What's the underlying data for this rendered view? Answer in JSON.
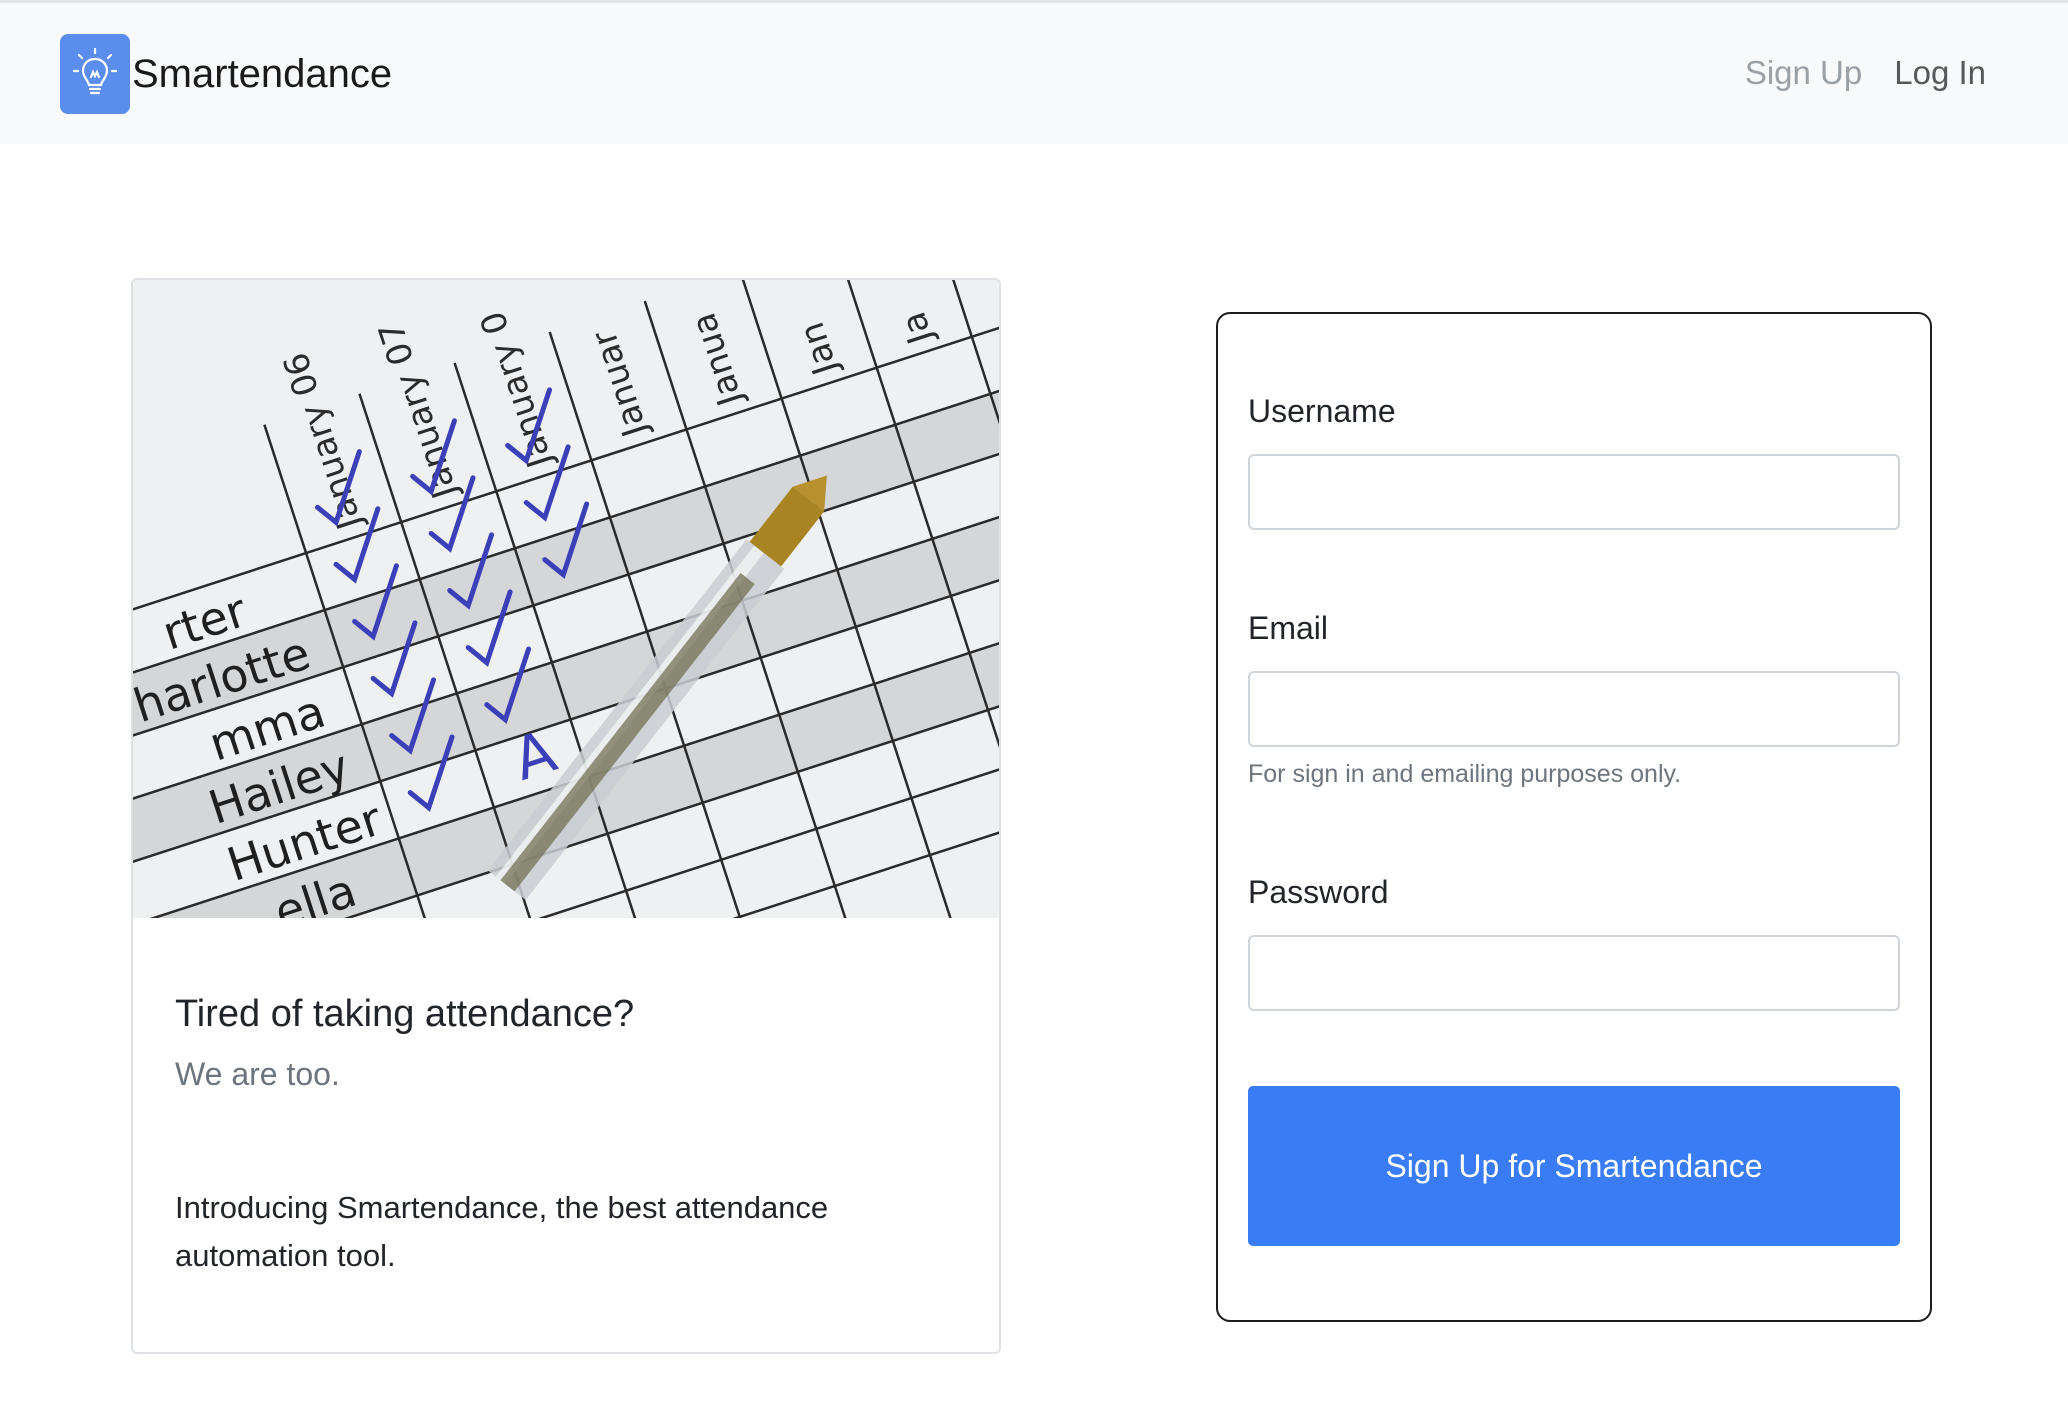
{
  "navbar": {
    "brand": "Smartendance",
    "links": [
      {
        "label": "Sign Up",
        "active": false
      },
      {
        "label": "Log In",
        "active": true
      }
    ]
  },
  "card": {
    "title": "Tired of taking attendance?",
    "subtitle": "We are too.",
    "text": "Introducing Smartendance, the best attendance automation tool.",
    "image": {
      "column_headers": [
        "January 06",
        "January 07",
        "January 0",
        "Januar",
        "Janua",
        "Jan",
        "Ja"
      ],
      "row_names": [
        "rter",
        "harlotte",
        "mma",
        "Hailey",
        "Hunter",
        "ella"
      ],
      "absence_mark": "A"
    }
  },
  "form": {
    "username_label": "Username",
    "username_value": "",
    "email_label": "Email",
    "email_value": "",
    "email_help": "For sign in and emailing purposes only.",
    "password_label": "Password",
    "password_value": "",
    "submit_label": "Sign Up for Smartendance"
  },
  "colors": {
    "brand_logo_bg": "#5b8def",
    "primary_button": "#3a7cf5",
    "navbar_bg": "#f8f9fa",
    "muted_text": "#6c757d"
  }
}
